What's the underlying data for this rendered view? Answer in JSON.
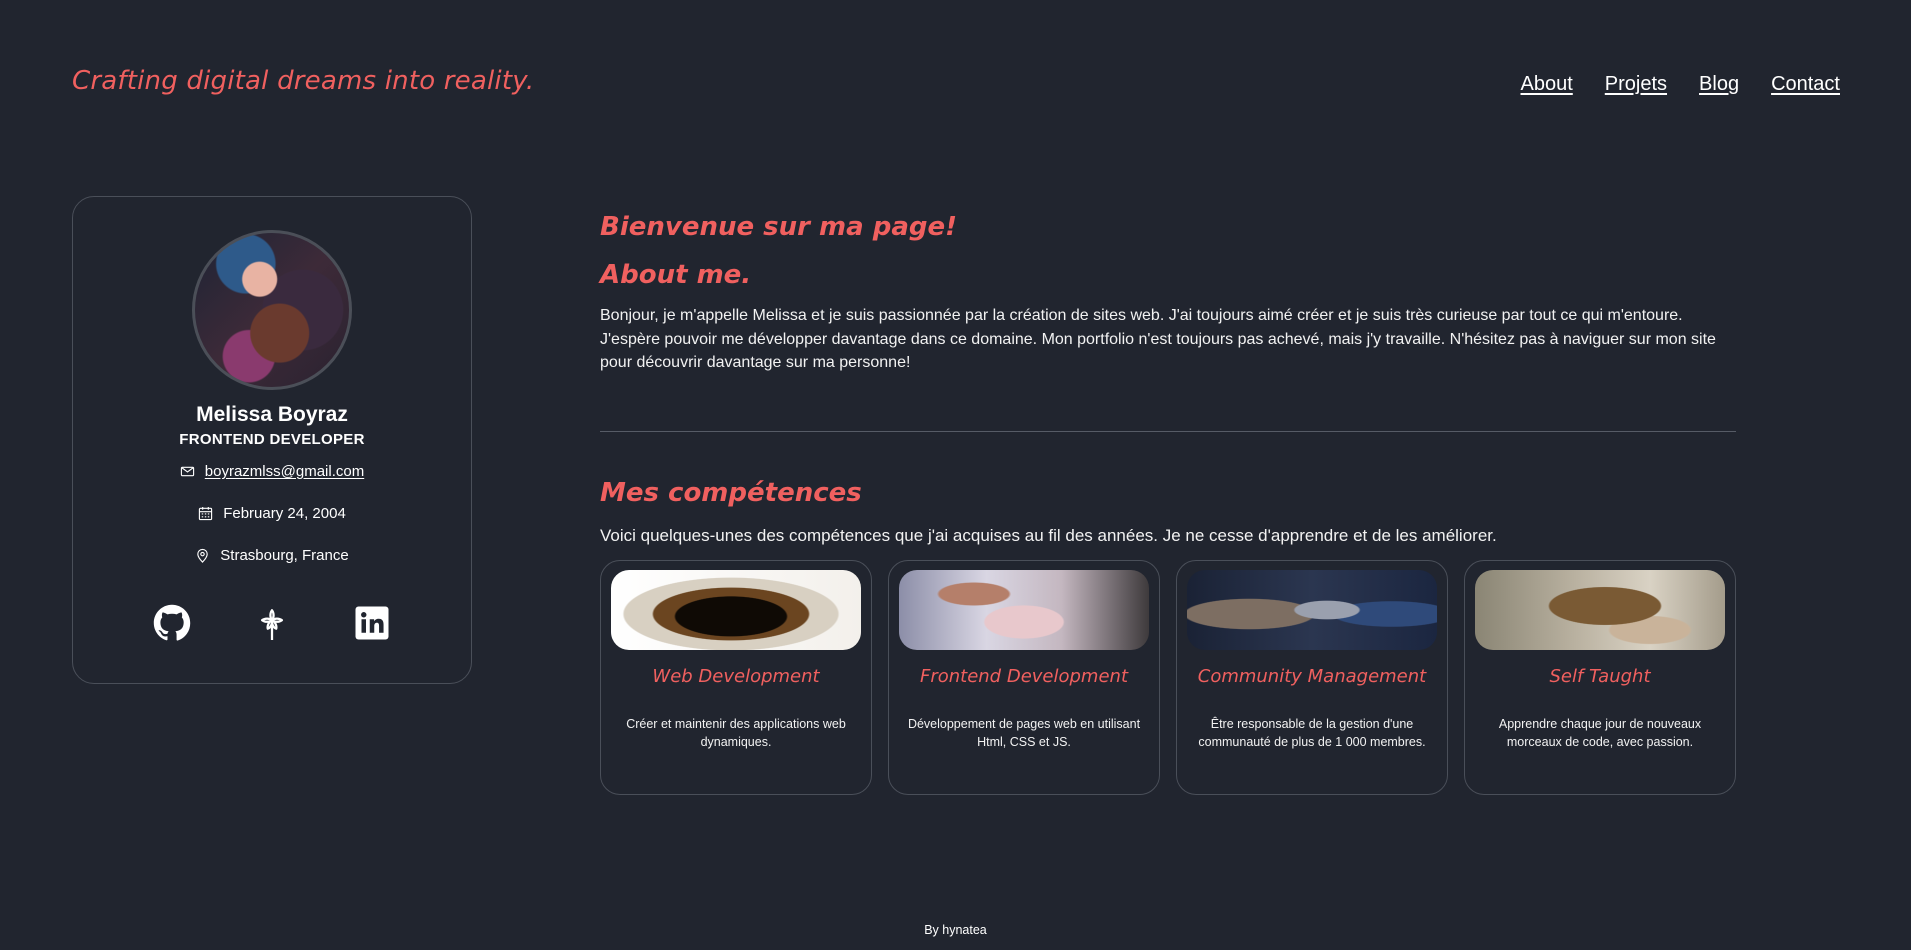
{
  "header": {
    "tagline": "Crafting digital dreams into reality.",
    "nav": [
      "About",
      "Projets",
      "Blog",
      "Contact"
    ]
  },
  "profile": {
    "name": "Melissa Boyraz",
    "role": "FRONTEND DEVELOPER",
    "email": "boyrazmlss@gmail.com",
    "birthdate": "February 24, 2004",
    "location": "Strasbourg, France",
    "socials": [
      "github-icon",
      "flower-icon",
      "linkedin-icon"
    ]
  },
  "main": {
    "welcome": "Bienvenue sur ma page!",
    "about_title": "About me.",
    "about_text": "Bonjour, je m'appelle Melissa et je suis passionnée par la création de sites web. J'ai toujours aimé créer et je suis très curieuse par tout ce qui m'entoure. J'espère pouvoir me développer davantage dans ce domaine. Mon portfolio n'est toujours pas achevé, mais j'y travaille. N'hésitez pas à naviguer sur mon site pour découvrir davantage sur ma personne!",
    "skills_title": "Mes compétences",
    "skills_intro": "Voici quelques-unes des compétences que j'ai acquises au fil des années. Je ne cesse d'apprendre et de les améliorer.",
    "skills": [
      {
        "title": "Web Development",
        "desc": "Créer et maintenir des applications web dynamiques."
      },
      {
        "title": "Frontend Development",
        "desc": "Développement de pages web en utilisant Html, CSS et JS."
      },
      {
        "title": "Community Management",
        "desc": "Être responsable de la gestion d'une communauté de plus de 1 000 membres."
      },
      {
        "title": "Self Taught",
        "desc": "Apprendre chaque jour de nouveaux morceaux de code, avec passion."
      }
    ]
  },
  "footer": {
    "text": "By hynatea"
  },
  "colors": {
    "background": "#21252f",
    "accent": "#f0605f",
    "border": "#4a4f59"
  }
}
